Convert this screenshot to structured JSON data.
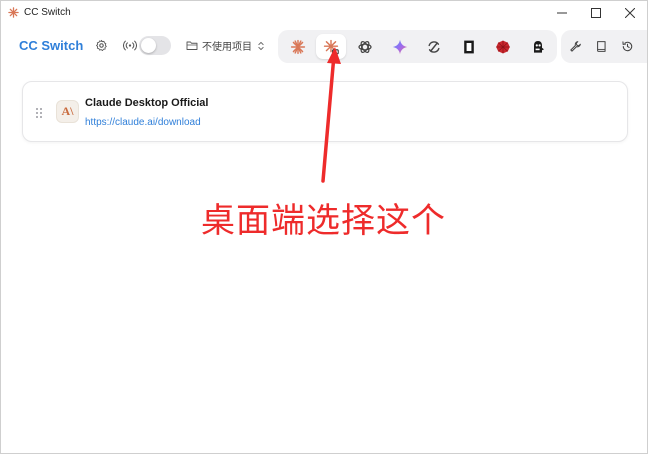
{
  "window": {
    "title": "CC Switch"
  },
  "header": {
    "brand": "CC Switch",
    "project_label": "不使用项目",
    "proxy_toggle_on": false
  },
  "app_switcher": {
    "selected_index": 1,
    "items": [
      {
        "icon": "claude-code-icon"
      },
      {
        "icon": "claude-desktop-icon"
      },
      {
        "icon": "openai-icon"
      },
      {
        "icon": "gemini-icon"
      },
      {
        "icon": "refresh-circle-icon"
      },
      {
        "icon": "opencode-icon"
      },
      {
        "icon": "red-gem-icon"
      },
      {
        "icon": "mascot-icon"
      }
    ]
  },
  "tools": [
    {
      "icon": "wrench-icon"
    },
    {
      "icon": "book-icon"
    },
    {
      "icon": "history-icon"
    }
  ],
  "card": {
    "title": "Claude Desktop Official",
    "link": "https://claude.ai/download",
    "logo_text": "A\\"
  },
  "annotation": {
    "text": "桌面端选择这个"
  },
  "colors": {
    "accent": "#2f7fd9",
    "annotation": "#ee2b2b",
    "claude": "#d97757"
  }
}
